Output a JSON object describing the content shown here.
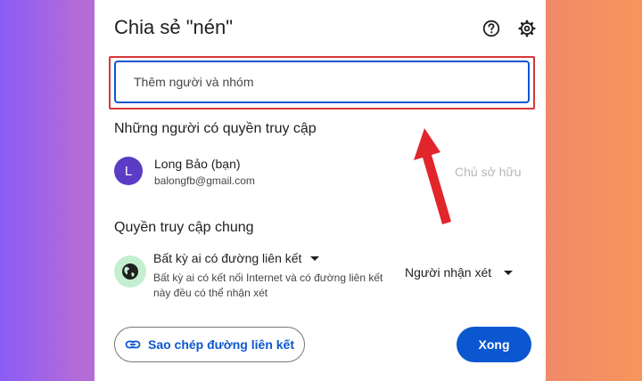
{
  "dialog": {
    "title": "Chia sẻ \"nén\"",
    "help_icon": "help-circle-icon",
    "settings_icon": "gear-icon"
  },
  "share_input": {
    "placeholder": "Thêm người và nhóm"
  },
  "people_section": {
    "heading": "Những người có quyền truy cập",
    "people": [
      {
        "avatar_letter": "L",
        "avatar_color": "#5b3cc4",
        "name": "Long Bảo (bạn)",
        "email": "balongfb@gmail.com",
        "role": "Chủ sở hữu"
      }
    ]
  },
  "general_access": {
    "heading": "Quyền truy cập chung",
    "icon": "globe-icon",
    "access_type": "Bất kỳ ai có đường liên kết",
    "description": "Bất kỳ ai có kết nối Internet và có đường liên kết này đều có thể nhận xét",
    "role": "Người nhận xét"
  },
  "footer": {
    "copy_link_label": "Sao chép đường liên kết",
    "copy_link_icon": "link-icon",
    "done_label": "Xong"
  },
  "colors": {
    "accent": "#0b57d0",
    "highlight_box": "#d8373a",
    "annotation_arrow": "#e0262b",
    "globe_bg": "#c4eed0"
  }
}
